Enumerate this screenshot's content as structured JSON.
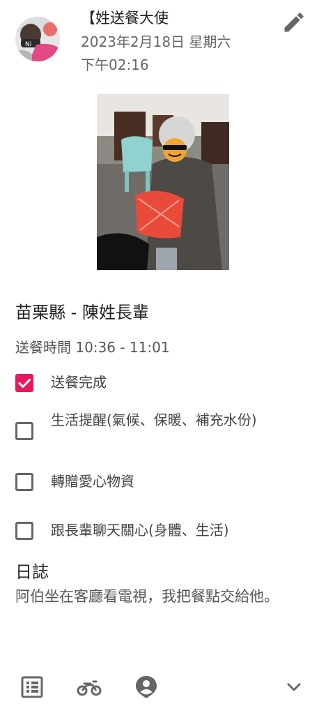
{
  "header": {
    "sender_name": "【姓送餐大使",
    "date": "2023年2月18日 星期六",
    "time": "下午02:16"
  },
  "recipient": {
    "title": "苗栗縣 - 陳姓長輩",
    "delivery_time": "送餐時間 10:36 - 11:01"
  },
  "tasks": [
    {
      "label": "送餐完成",
      "checked": true
    },
    {
      "label": "生活提醒(氣候、保暖、補充水份)",
      "checked": false
    },
    {
      "label": "轉贈愛心物資",
      "checked": false
    },
    {
      "label": "跟長輩聊天關心(身體、生活)",
      "checked": false
    }
  ],
  "log": {
    "title": "日誌",
    "text": "阿伯坐在客廳看電視，我把餐點交給他。"
  },
  "icons": {
    "edit": "pencil-icon",
    "check": "check-icon",
    "nav": [
      "list-icon",
      "motorcycle-icon",
      "person-pin-icon",
      "chevron-down-icon"
    ]
  },
  "colors": {
    "accent": "#e8185e",
    "icon_gray": "#666666"
  }
}
